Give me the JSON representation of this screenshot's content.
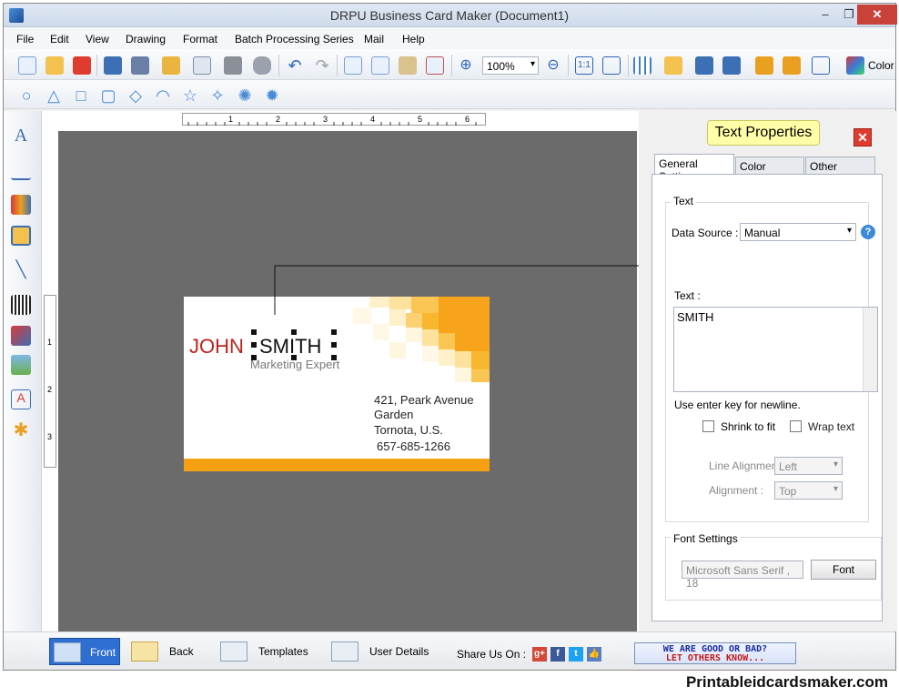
{
  "window": {
    "title": "DRPU Business Card Maker (Document1)"
  },
  "menu": [
    "File",
    "Edit",
    "View",
    "Drawing",
    "Format",
    "Batch Processing Series",
    "Mail",
    "Help"
  ],
  "toolbar": {
    "zoom": "100%",
    "color_label": "Color"
  },
  "ruler": {
    "h": [
      "1",
      "2",
      "3",
      "4",
      "5",
      "6"
    ],
    "v": [
      "1",
      "2",
      "3"
    ]
  },
  "card": {
    "first_name": "JOHN",
    "last_name": "SMITH",
    "job_title": "Marketing Expert",
    "address_line1": "421, Peark Avenue",
    "address_line2": "Garden",
    "address_line3": "Tornota, U.S.",
    "phone": "657-685-1266"
  },
  "panel": {
    "title": "Text Properties",
    "tabs": [
      "General Settings",
      "Color Settings",
      "Other Settings"
    ],
    "text_group": "Text",
    "data_source_label": "Data Source :",
    "data_source_value": "Manual",
    "text_label": "Text :",
    "text_value": "SMITH",
    "hint": "Use enter key for newline.",
    "shrink_label": "Shrink to fit",
    "wrap_label": "Wrap text",
    "line_alignment_label": "Line Alignment",
    "line_alignment_value": "Left",
    "alignment_label": "Alignment :",
    "alignment_value": "Top",
    "font_group": "Font Settings",
    "font_value": "Microsoft Sans Serif , 18",
    "font_button": "Font"
  },
  "bottom": {
    "front": "Front",
    "back": "Back",
    "templates": "Templates",
    "user_details": "User Details",
    "share": "Share Us On :",
    "feedback_line1": "WE ARE GOOD OR BAD?",
    "feedback_line2": "LET OTHERS KNOW..."
  },
  "watermark": "Printableidcardsmaker.com",
  "colors": {
    "accent": "#f5a012",
    "name_red": "#c0221d",
    "active_tab": "#2f6fd1"
  }
}
